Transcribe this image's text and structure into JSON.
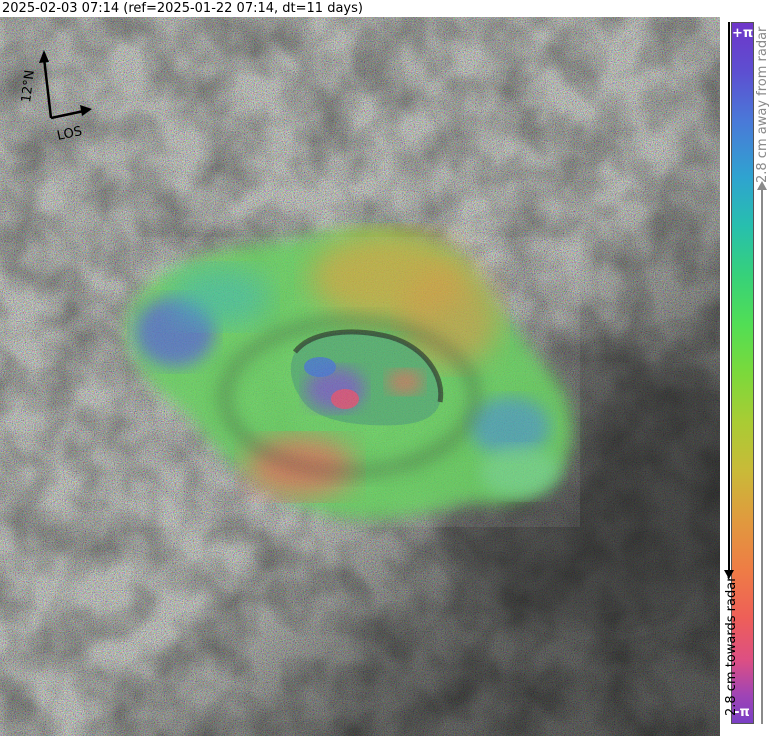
{
  "title": "2025-02-03 07:14 (ref=2025-01-22 07:14, dt=11 days)",
  "compass": {
    "north_label": "12°N",
    "los_label": "LOS"
  },
  "colorbar": {
    "top_label": "+π",
    "bottom_label": "-π",
    "away_label": "2.8 cm away from radar",
    "towards_label": "2.8 cm towards radar"
  }
}
